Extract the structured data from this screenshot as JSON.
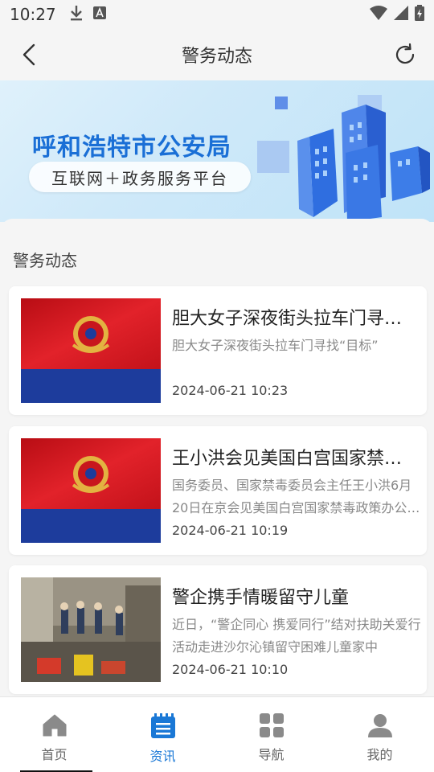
{
  "status_bar": {
    "time": "10:27"
  },
  "header": {
    "title": "警务动态"
  },
  "banner": {
    "title": "呼和浩特市公安局",
    "subtitle": "互联网＋政务服务平台"
  },
  "section": {
    "title": "警务动态"
  },
  "news": [
    {
      "headline": "胆大女子深夜街头拉车门寻找“目标”",
      "summary": "胆大女子深夜街头拉车门寻找“目标”",
      "time": "2024-06-21 10:23",
      "thumb": "police-flag"
    },
    {
      "headline": "王小洪会见美国白宫国家禁毒政策办公室主任",
      "summary": "国务委员、国家禁毒委员会主任王小洪6月20日在京会见美国白宫国家禁毒政策办公室主任",
      "time": "2024-06-21 10:19",
      "thumb": "police-flag"
    },
    {
      "headline": "警企携手情暖留守儿童",
      "summary": "近日，“警企同心 携爱同行”结对扶助关爱行活动走进沙尔沁镇留守困难儿童家中",
      "time": "2024-06-21 10:10",
      "thumb": "photo"
    }
  ],
  "bottom_nav": {
    "items": [
      {
        "label": "首页",
        "icon": "home-icon"
      },
      {
        "label": "资讯",
        "icon": "news-icon",
        "active": true
      },
      {
        "label": "导航",
        "icon": "grid-icon"
      },
      {
        "label": "我的",
        "icon": "user-icon"
      }
    ]
  },
  "colors": {
    "accent": "#1a78d6",
    "banner_title": "#1a6fd6",
    "flag_red": "#d3141b",
    "flag_blue": "#1d3c9c"
  }
}
